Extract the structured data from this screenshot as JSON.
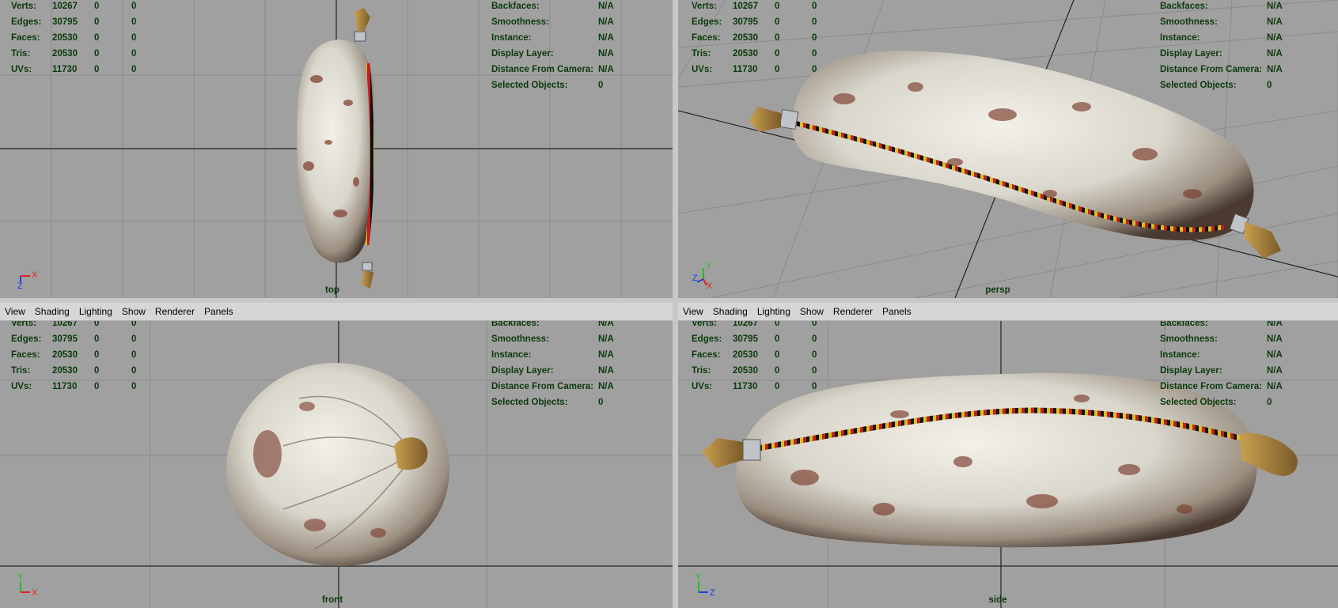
{
  "menu": [
    "View",
    "Shading",
    "Lighting",
    "Show",
    "Renderer",
    "Panels"
  ],
  "hud_left": [
    {
      "label": "Verts:",
      "value": "10267",
      "a": "0",
      "b": "0"
    },
    {
      "label": "Edges:",
      "value": "30795",
      "a": "0",
      "b": "0"
    },
    {
      "label": "Faces:",
      "value": "20530",
      "a": "0",
      "b": "0"
    },
    {
      "label": "Tris:",
      "value": "20530",
      "a": "0",
      "b": "0"
    },
    {
      "label": "UVs:",
      "value": "11730",
      "a": "0",
      "b": "0"
    }
  ],
  "hud_right": [
    {
      "label": "Backfaces:",
      "value": "N/A"
    },
    {
      "label": "Smoothness:",
      "value": "N/A"
    },
    {
      "label": "Instance:",
      "value": "N/A"
    },
    {
      "label": "Display Layer:",
      "value": "N/A"
    },
    {
      "label": "Distance From Camera:",
      "value": "N/A"
    },
    {
      "label": "Selected Objects:",
      "value": "0"
    }
  ],
  "panels": [
    {
      "camera": "top",
      "axes": [
        "Z",
        "X"
      ]
    },
    {
      "camera": "persp",
      "axes": [
        "Y",
        "Z",
        "X"
      ]
    },
    {
      "camera": "front",
      "axes": [
        "Y",
        "X"
      ]
    },
    {
      "camera": "side",
      "axes": [
        "Y",
        "Z"
      ]
    }
  ],
  "colors": {
    "viewport_bg": "#a0a0a0",
    "hud_text": "#0b3a0b",
    "active_outline": "#6fa0e0",
    "axis_x": "#e02020",
    "axis_y": "#20c020",
    "axis_z": "#2040e0"
  }
}
